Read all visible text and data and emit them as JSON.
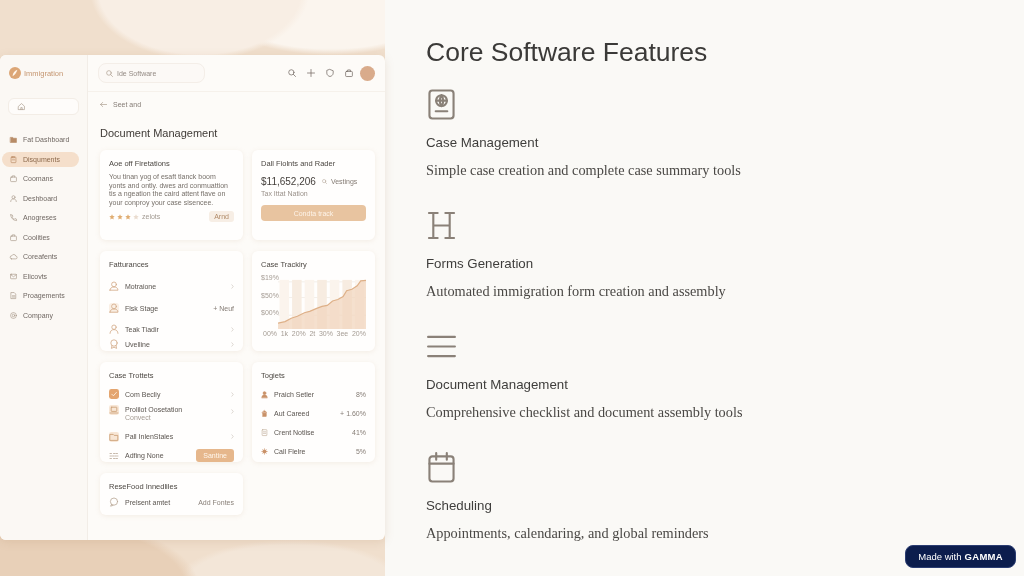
{
  "title": "Core Software Features",
  "features": [
    {
      "heading": "Case Management",
      "description": "Simple case creation and complete case summary tools"
    },
    {
      "heading": "Forms Generation",
      "description": "Automated immigration form creation and assembly"
    },
    {
      "heading": "Document Management",
      "description": "Comprehensive checklist and document assembly tools"
    },
    {
      "heading": "Scheduling",
      "description": "Appointments, calendaring, and global reminders"
    }
  ],
  "mockup": {
    "app_name": "Immigration",
    "sidebar": {
      "items": [
        {
          "label": "Fat Dashboard",
          "selected": false
        },
        {
          "label": "Disquments",
          "selected": true
        },
        {
          "label": "Coomans",
          "selected": false
        },
        {
          "label": "Deshboard",
          "selected": false
        },
        {
          "label": "Anogreses",
          "selected": false
        },
        {
          "label": "Coolities",
          "selected": false
        },
        {
          "label": "Coreafents",
          "selected": false
        },
        {
          "label": "Elicovts",
          "selected": false
        },
        {
          "label": "Proagements",
          "selected": false
        },
        {
          "label": "Company",
          "selected": false
        }
      ]
    },
    "search": {
      "placeholder": "Ide Software"
    },
    "back_link": "Seet and",
    "page_title": "Document Management",
    "summary_card": {
      "title": "Aoe off Firetations",
      "body": "You tinan yog of esaft tlanck boom yonts and ontly. dwes ard conmuattion tis a ngeation the caird attent flave on your conproy your case sisencee.",
      "stars": 3,
      "rating_label": "zelots",
      "tag": "Arnd"
    },
    "amount_card": {
      "title": "Dall Fiolnts and Rader",
      "amount": "$11,652,206",
      "amount_note": "Vestings",
      "subtitle": "Tax Ittat Nation",
      "button": "Condta track"
    },
    "features_card": {
      "title": "Fatturances",
      "rows": [
        {
          "label": "Motraione"
        },
        {
          "label": "Flsk Stage",
          "value": "+ Neuf"
        },
        {
          "label": "Teak Tiadir"
        },
        {
          "label": "Uvelline"
        }
      ]
    },
    "tracking_card": {
      "title": "Case Trackiry",
      "y_labels": [
        "$19%",
        "$50%",
        "$00%"
      ],
      "x_labels": [
        "00%",
        "1k",
        "20%",
        "2t",
        "30%",
        "3ee",
        "20%"
      ]
    },
    "tasks_card": {
      "title": "Case Trottets",
      "rows": [
        {
          "label": "Com Becliy"
        },
        {
          "label": "Prolilot Oosetation",
          "sublabel": "Convect"
        },
        {
          "label": "Pall InlenStales"
        },
        {
          "label": "Adfing None",
          "button": "Santine"
        }
      ]
    },
    "targets_card": {
      "title": "Togiets",
      "rows": [
        {
          "label": "Praich Setler",
          "value": "8%"
        },
        {
          "label": "Aut Careed",
          "value": "+ 1.60%"
        },
        {
          "label": "Crent Notlise",
          "value": "41%"
        },
        {
          "label": "Call Flelre",
          "value": "5%"
        }
      ]
    },
    "resources_card": {
      "title": "ReseFood Innedliles",
      "rows": [
        {
          "label": "Prelsent amtet",
          "action": "Add Fontes"
        }
      ]
    }
  },
  "badge": "Made with **GAMMA**"
}
